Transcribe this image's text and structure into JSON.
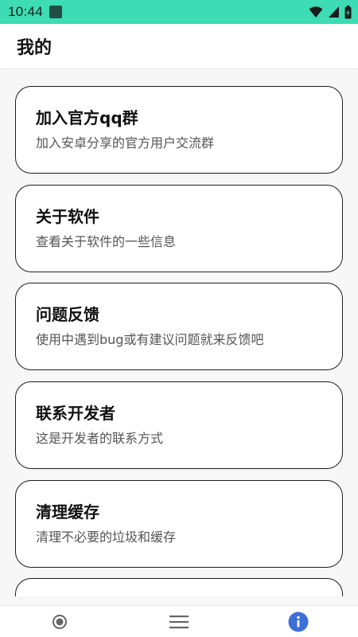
{
  "status_bar": {
    "time": "10:44"
  },
  "app_bar": {
    "title": "我的"
  },
  "cards": [
    {
      "title": "加入官方qq群",
      "subtitle": "加入安卓分享的官方用户交流群"
    },
    {
      "title": "关于软件",
      "subtitle": "查看关于软件的一些信息"
    },
    {
      "title": "问题反馈",
      "subtitle": "使用中遇到bug或有建议问题就来反馈吧"
    },
    {
      "title": "联系开发者",
      "subtitle": "这是开发者的联系方式"
    },
    {
      "title": "清理缓存",
      "subtitle": "清理不必要的垃圾和缓存"
    }
  ],
  "bottom_nav": {
    "items": [
      {
        "icon": "radio-circle-icon",
        "active": false
      },
      {
        "icon": "menu-icon",
        "active": false
      },
      {
        "icon": "info-icon",
        "active": true
      }
    ]
  },
  "colors": {
    "status_bar": "#3ddcb4",
    "accent": "#3d6fd9"
  }
}
